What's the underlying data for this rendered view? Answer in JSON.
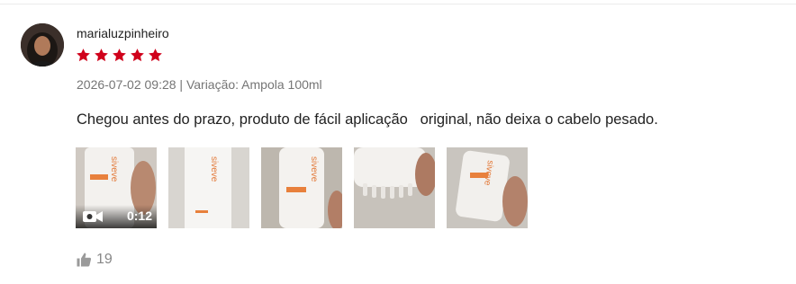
{
  "review": {
    "username": "marialuzpinheiro",
    "rating": 5,
    "rating_max": 5,
    "star_color": "#d0011b",
    "meta": "2026-07-02 09:28 | Variação: Ampola 100ml",
    "comment": "Chegou antes do prazo, produto de fácil aplicação   original, não deixa o cabelo pesado.",
    "media": [
      {
        "type": "video",
        "duration": "0:12",
        "icon": "video-camera-icon"
      },
      {
        "type": "image"
      },
      {
        "type": "image"
      },
      {
        "type": "image"
      },
      {
        "type": "image"
      }
    ],
    "likes": {
      "icon": "thumbs-up-icon",
      "count": "19"
    }
  }
}
